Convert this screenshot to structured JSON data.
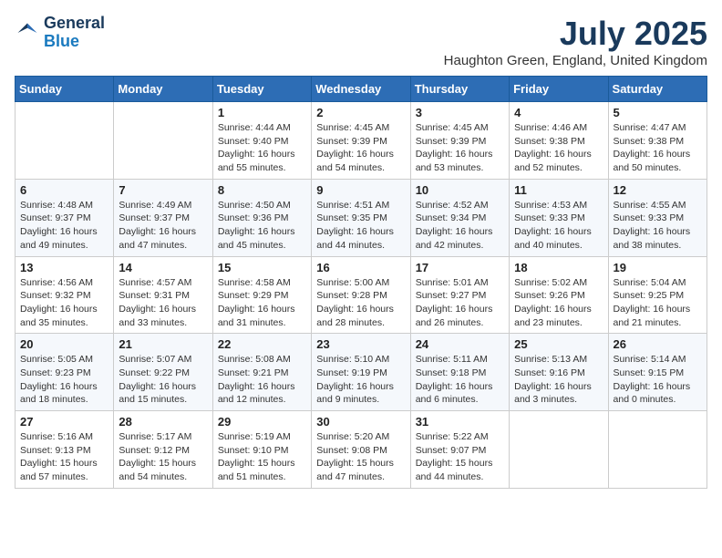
{
  "header": {
    "logo_line1": "General",
    "logo_line2": "Blue",
    "month_title": "July 2025",
    "location": "Haughton Green, England, United Kingdom"
  },
  "weekdays": [
    "Sunday",
    "Monday",
    "Tuesday",
    "Wednesday",
    "Thursday",
    "Friday",
    "Saturday"
  ],
  "weeks": [
    [
      {
        "day": "",
        "sunrise": "",
        "sunset": "",
        "daylight": ""
      },
      {
        "day": "",
        "sunrise": "",
        "sunset": "",
        "daylight": ""
      },
      {
        "day": "1",
        "sunrise": "Sunrise: 4:44 AM",
        "sunset": "Sunset: 9:40 PM",
        "daylight": "Daylight: 16 hours and 55 minutes."
      },
      {
        "day": "2",
        "sunrise": "Sunrise: 4:45 AM",
        "sunset": "Sunset: 9:39 PM",
        "daylight": "Daylight: 16 hours and 54 minutes."
      },
      {
        "day": "3",
        "sunrise": "Sunrise: 4:45 AM",
        "sunset": "Sunset: 9:39 PM",
        "daylight": "Daylight: 16 hours and 53 minutes."
      },
      {
        "day": "4",
        "sunrise": "Sunrise: 4:46 AM",
        "sunset": "Sunset: 9:38 PM",
        "daylight": "Daylight: 16 hours and 52 minutes."
      },
      {
        "day": "5",
        "sunrise": "Sunrise: 4:47 AM",
        "sunset": "Sunset: 9:38 PM",
        "daylight": "Daylight: 16 hours and 50 minutes."
      }
    ],
    [
      {
        "day": "6",
        "sunrise": "Sunrise: 4:48 AM",
        "sunset": "Sunset: 9:37 PM",
        "daylight": "Daylight: 16 hours and 49 minutes."
      },
      {
        "day": "7",
        "sunrise": "Sunrise: 4:49 AM",
        "sunset": "Sunset: 9:37 PM",
        "daylight": "Daylight: 16 hours and 47 minutes."
      },
      {
        "day": "8",
        "sunrise": "Sunrise: 4:50 AM",
        "sunset": "Sunset: 9:36 PM",
        "daylight": "Daylight: 16 hours and 45 minutes."
      },
      {
        "day": "9",
        "sunrise": "Sunrise: 4:51 AM",
        "sunset": "Sunset: 9:35 PM",
        "daylight": "Daylight: 16 hours and 44 minutes."
      },
      {
        "day": "10",
        "sunrise": "Sunrise: 4:52 AM",
        "sunset": "Sunset: 9:34 PM",
        "daylight": "Daylight: 16 hours and 42 minutes."
      },
      {
        "day": "11",
        "sunrise": "Sunrise: 4:53 AM",
        "sunset": "Sunset: 9:33 PM",
        "daylight": "Daylight: 16 hours and 40 minutes."
      },
      {
        "day": "12",
        "sunrise": "Sunrise: 4:55 AM",
        "sunset": "Sunset: 9:33 PM",
        "daylight": "Daylight: 16 hours and 38 minutes."
      }
    ],
    [
      {
        "day": "13",
        "sunrise": "Sunrise: 4:56 AM",
        "sunset": "Sunset: 9:32 PM",
        "daylight": "Daylight: 16 hours and 35 minutes."
      },
      {
        "day": "14",
        "sunrise": "Sunrise: 4:57 AM",
        "sunset": "Sunset: 9:31 PM",
        "daylight": "Daylight: 16 hours and 33 minutes."
      },
      {
        "day": "15",
        "sunrise": "Sunrise: 4:58 AM",
        "sunset": "Sunset: 9:29 PM",
        "daylight": "Daylight: 16 hours and 31 minutes."
      },
      {
        "day": "16",
        "sunrise": "Sunrise: 5:00 AM",
        "sunset": "Sunset: 9:28 PM",
        "daylight": "Daylight: 16 hours and 28 minutes."
      },
      {
        "day": "17",
        "sunrise": "Sunrise: 5:01 AM",
        "sunset": "Sunset: 9:27 PM",
        "daylight": "Daylight: 16 hours and 26 minutes."
      },
      {
        "day": "18",
        "sunrise": "Sunrise: 5:02 AM",
        "sunset": "Sunset: 9:26 PM",
        "daylight": "Daylight: 16 hours and 23 minutes."
      },
      {
        "day": "19",
        "sunrise": "Sunrise: 5:04 AM",
        "sunset": "Sunset: 9:25 PM",
        "daylight": "Daylight: 16 hours and 21 minutes."
      }
    ],
    [
      {
        "day": "20",
        "sunrise": "Sunrise: 5:05 AM",
        "sunset": "Sunset: 9:23 PM",
        "daylight": "Daylight: 16 hours and 18 minutes."
      },
      {
        "day": "21",
        "sunrise": "Sunrise: 5:07 AM",
        "sunset": "Sunset: 9:22 PM",
        "daylight": "Daylight: 16 hours and 15 minutes."
      },
      {
        "day": "22",
        "sunrise": "Sunrise: 5:08 AM",
        "sunset": "Sunset: 9:21 PM",
        "daylight": "Daylight: 16 hours and 12 minutes."
      },
      {
        "day": "23",
        "sunrise": "Sunrise: 5:10 AM",
        "sunset": "Sunset: 9:19 PM",
        "daylight": "Daylight: 16 hours and 9 minutes."
      },
      {
        "day": "24",
        "sunrise": "Sunrise: 5:11 AM",
        "sunset": "Sunset: 9:18 PM",
        "daylight": "Daylight: 16 hours and 6 minutes."
      },
      {
        "day": "25",
        "sunrise": "Sunrise: 5:13 AM",
        "sunset": "Sunset: 9:16 PM",
        "daylight": "Daylight: 16 hours and 3 minutes."
      },
      {
        "day": "26",
        "sunrise": "Sunrise: 5:14 AM",
        "sunset": "Sunset: 9:15 PM",
        "daylight": "Daylight: 16 hours and 0 minutes."
      }
    ],
    [
      {
        "day": "27",
        "sunrise": "Sunrise: 5:16 AM",
        "sunset": "Sunset: 9:13 PM",
        "daylight": "Daylight: 15 hours and 57 minutes."
      },
      {
        "day": "28",
        "sunrise": "Sunrise: 5:17 AM",
        "sunset": "Sunset: 9:12 PM",
        "daylight": "Daylight: 15 hours and 54 minutes."
      },
      {
        "day": "29",
        "sunrise": "Sunrise: 5:19 AM",
        "sunset": "Sunset: 9:10 PM",
        "daylight": "Daylight: 15 hours and 51 minutes."
      },
      {
        "day": "30",
        "sunrise": "Sunrise: 5:20 AM",
        "sunset": "Sunset: 9:08 PM",
        "daylight": "Daylight: 15 hours and 47 minutes."
      },
      {
        "day": "31",
        "sunrise": "Sunrise: 5:22 AM",
        "sunset": "Sunset: 9:07 PM",
        "daylight": "Daylight: 15 hours and 44 minutes."
      },
      {
        "day": "",
        "sunrise": "",
        "sunset": "",
        "daylight": ""
      },
      {
        "day": "",
        "sunrise": "",
        "sunset": "",
        "daylight": ""
      }
    ]
  ]
}
